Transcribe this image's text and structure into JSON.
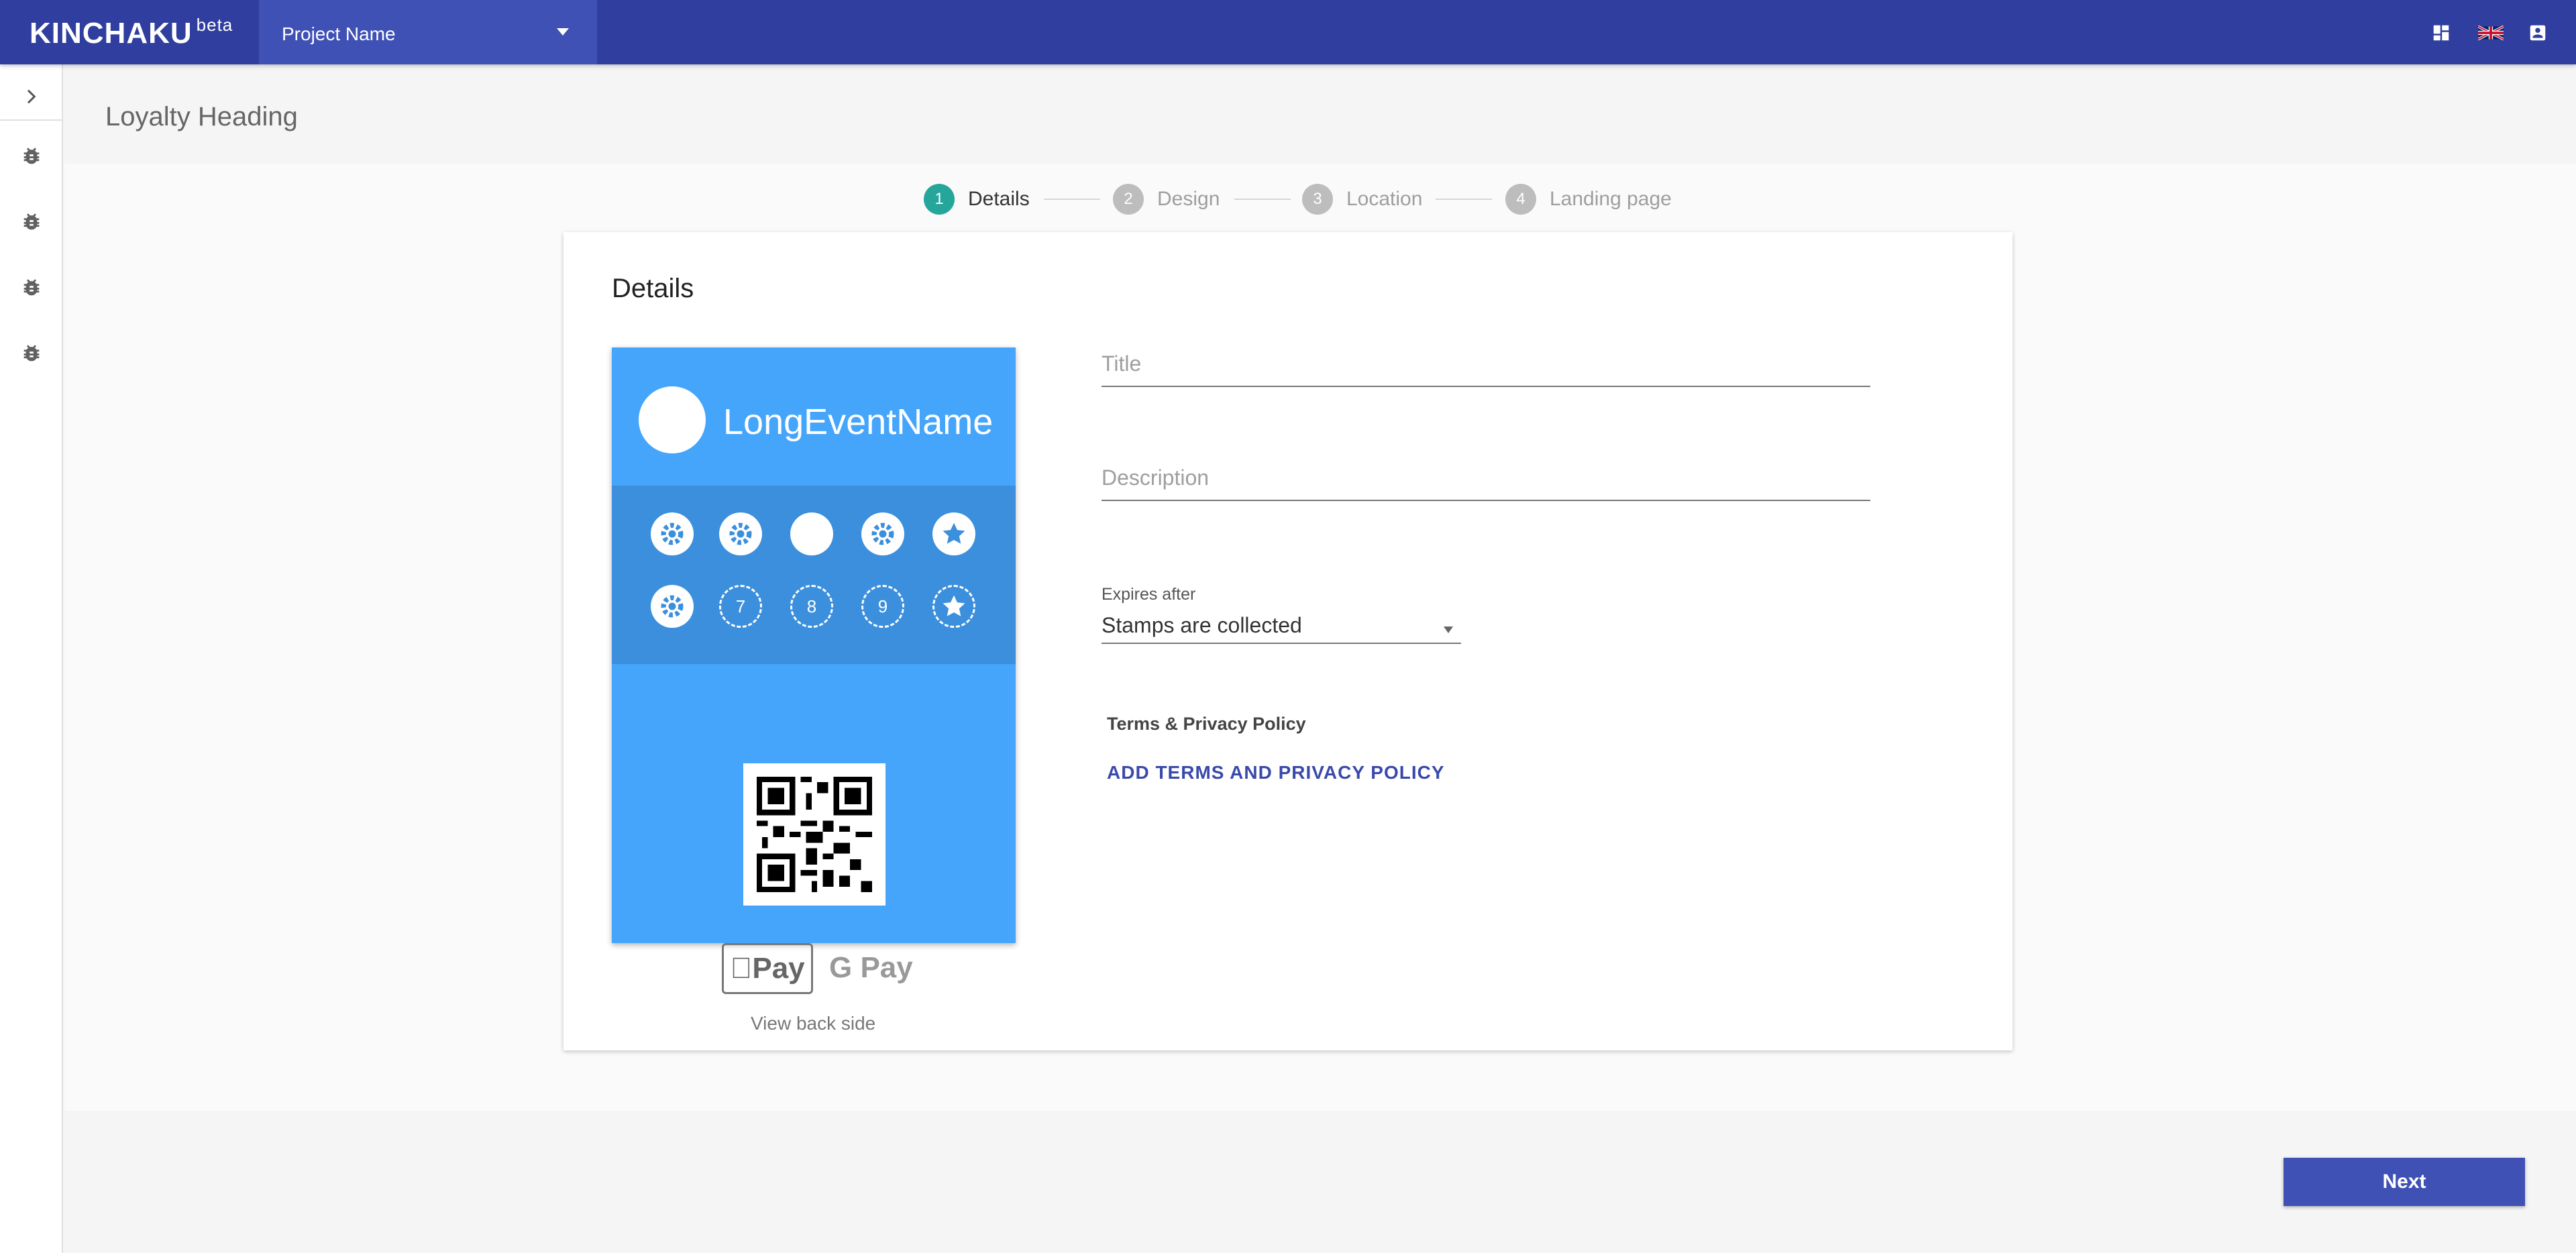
{
  "app": {
    "name": "KINCHAKU",
    "badge": "beta"
  },
  "header": {
    "project_select": "Project Name",
    "icons": [
      "dashboard-icon",
      "uk-flag-icon",
      "account-icon"
    ]
  },
  "sidebar": {
    "items": [
      "chevron-right-icon",
      "bug-icon",
      "bug-icon",
      "bug-icon",
      "bug-icon"
    ]
  },
  "page": {
    "heading": "Loyalty Heading"
  },
  "stepper": {
    "steps": [
      {
        "num": "1",
        "label": "Details",
        "active": true
      },
      {
        "num": "2",
        "label": "Design",
        "active": false
      },
      {
        "num": "3",
        "label": "Location",
        "active": false
      },
      {
        "num": "4",
        "label": "Landing page",
        "active": false
      }
    ]
  },
  "card": {
    "title": "Details",
    "pass": {
      "event_name": "LongEventName",
      "stamps_row1": [
        "gear",
        "gear",
        "filled",
        "gear",
        "star"
      ],
      "stamps_row2": [
        "gear",
        "7",
        "8",
        "9",
        "star-empty"
      ]
    },
    "view_back": "View back side",
    "pay": {
      "apple": "Pay",
      "google": "G Pay"
    },
    "form": {
      "title_placeholder": "Title",
      "description_placeholder": "Description",
      "expires_label": "Expires after",
      "expires_value": "Stamps are collected",
      "terms_label": "Terms & Privacy Policy",
      "terms_link": "ADD TERMS AND PRIVACY POLICY"
    }
  },
  "footer": {
    "next_label": "Next"
  },
  "colors": {
    "primary": "#303f9f",
    "accent": "#26a69a",
    "pass": "#45a5fb"
  }
}
